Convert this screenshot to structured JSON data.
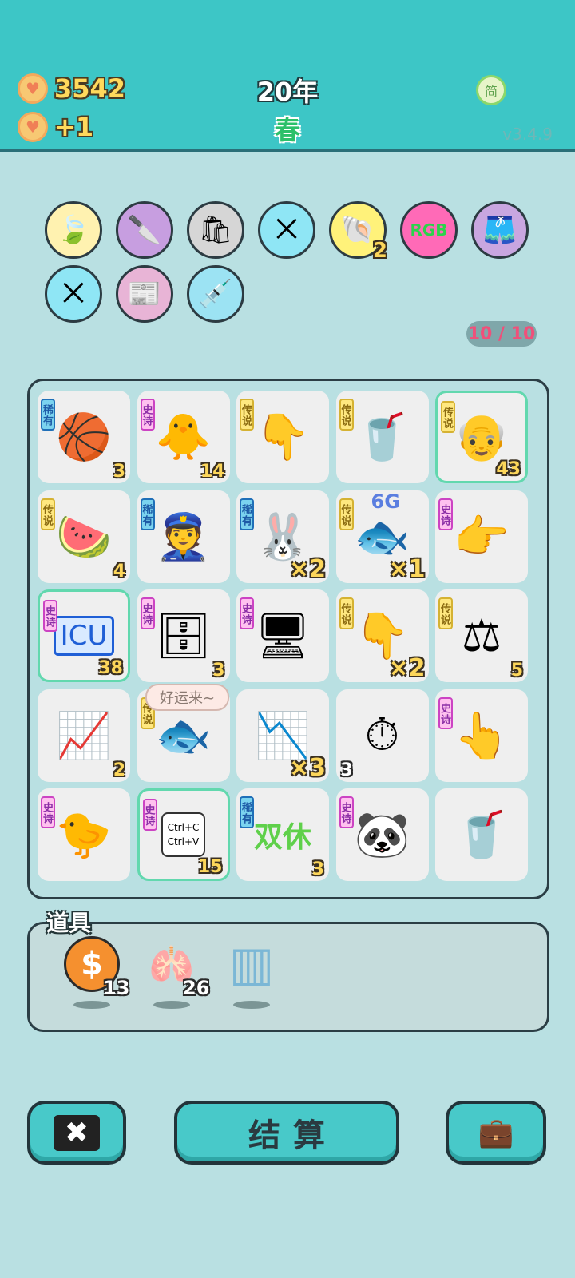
{
  "header": {
    "coins": "3542",
    "income": "+1",
    "year": "20年",
    "season": "春",
    "lang_label": "简",
    "version": "v3.4.9",
    "coin_icon": "heart-coin-icon"
  },
  "buffs": [
    {
      "name": "leaf-coin",
      "icon": "🍃",
      "bg": "#fff2b0",
      "count": ""
    },
    {
      "name": "cleaver",
      "icon": "🔪",
      "bg": "#c79ee0",
      "count": ""
    },
    {
      "name": "recycle-bag",
      "icon": "🛍",
      "bg": "#d6d6d6",
      "count": ""
    },
    {
      "name": "straws",
      "icon": "⨉",
      "bg": "#8fe6f5",
      "count": ""
    },
    {
      "name": "shell",
      "icon": "🐚",
      "bg": "#fff27a",
      "count": "2"
    },
    {
      "name": "rgb",
      "icon": "RGB",
      "bg": "#ff6ab7",
      "count": ""
    },
    {
      "name": "skirt",
      "icon": "🩳",
      "bg": "#c9a6e0",
      "count": ""
    },
    {
      "name": "straws-2",
      "icon": "⨉",
      "bg": "#8fe6f5",
      "count": ""
    },
    {
      "name": "time-magazine",
      "icon": "📰",
      "bg": "#e8b4d6",
      "count": ""
    },
    {
      "name": "syringe-chick",
      "icon": "💉",
      "bg": "#9ce3f3",
      "count": ""
    }
  ],
  "slot_counter": "10 / 10",
  "rarity_labels": {
    "rare": "稀有",
    "epic": "史诗",
    "legend": "传说"
  },
  "grid": [
    {
      "icon": "🏀",
      "rarity": "rare",
      "count": "3",
      "mult": "",
      "glow": false
    },
    {
      "icon": "🐥",
      "rarity": "epic",
      "count": "14",
      "mult": "",
      "glow": false
    },
    {
      "icon": "👇",
      "rarity": "legend",
      "count": "",
      "mult": "",
      "glow": false
    },
    {
      "icon": "🥤",
      "rarity": "legend",
      "count": "",
      "mult": "",
      "glow": false
    },
    {
      "icon": "👴",
      "rarity": "legend",
      "count": "43",
      "mult": "",
      "glow": true
    },
    {
      "icon": "🍉",
      "rarity": "legend",
      "count": "4",
      "mult": "",
      "glow": false
    },
    {
      "icon": "👮",
      "rarity": "rare",
      "count": "",
      "mult": "",
      "glow": false
    },
    {
      "icon": "🐰",
      "rarity": "rare",
      "count": "",
      "mult": "×2",
      "glow": false
    },
    {
      "icon": "🐟",
      "rarity": "legend",
      "count": "",
      "mult": "×1",
      "glow": false,
      "badge": "6G"
    },
    {
      "icon": "👉",
      "rarity": "epic",
      "count": "",
      "mult": "",
      "glow": false
    },
    {
      "icon": "ICU",
      "rarity": "epic",
      "count": "38",
      "mult": "",
      "glow": true
    },
    {
      "icon": "🗄",
      "rarity": "epic",
      "count": "3",
      "mult": "",
      "glow": false
    },
    {
      "icon": "🖥",
      "rarity": "epic",
      "count": "",
      "mult": "",
      "glow": false
    },
    {
      "icon": "👇",
      "rarity": "legend",
      "count": "",
      "mult": "×2",
      "glow": false
    },
    {
      "icon": "⚖",
      "rarity": "legend",
      "count": "5",
      "mult": "",
      "glow": false
    },
    {
      "icon": "📈",
      "rarity": "",
      "count": "2",
      "mult": "",
      "glow": false
    },
    {
      "icon": "🐟",
      "rarity": "legend",
      "count": "",
      "mult": "",
      "glow": false
    },
    {
      "icon": "📉",
      "rarity": "",
      "count": "",
      "mult": "×3",
      "glow": false
    },
    {
      "icon": "⏱",
      "rarity": "",
      "count": "3",
      "mult": "",
      "glow": false,
      "count_left": true
    },
    {
      "icon": "👆",
      "rarity": "epic",
      "count": "",
      "mult": "",
      "glow": false
    },
    {
      "icon": "🐤",
      "rarity": "epic",
      "count": "",
      "mult": "",
      "glow": false
    },
    {
      "icon": "Ctrl+C\nCtrl+V",
      "rarity": "epic",
      "count": "15",
      "mult": "",
      "glow": true
    },
    {
      "icon": "双休",
      "rarity": "rare",
      "count": "3",
      "mult": "",
      "glow": false
    },
    {
      "icon": "🐼",
      "rarity": "epic",
      "count": "",
      "mult": "",
      "glow": false
    },
    {
      "icon": "🥤",
      "rarity": "",
      "count": "",
      "mult": "",
      "glow": false
    }
  ],
  "speech_bubble": "好运来~",
  "props": {
    "label": "道具",
    "items": [
      {
        "name": "coin-prop",
        "icon": "$",
        "count": "13"
      },
      {
        "name": "liver-prop",
        "icon": "🫁",
        "count": "26"
      },
      {
        "name": "rare-pack-prop",
        "icon": "▥",
        "count": ""
      }
    ]
  },
  "buttons": {
    "discard_icon": "✖",
    "settle_label": "结算",
    "bag_icon": "💼"
  }
}
